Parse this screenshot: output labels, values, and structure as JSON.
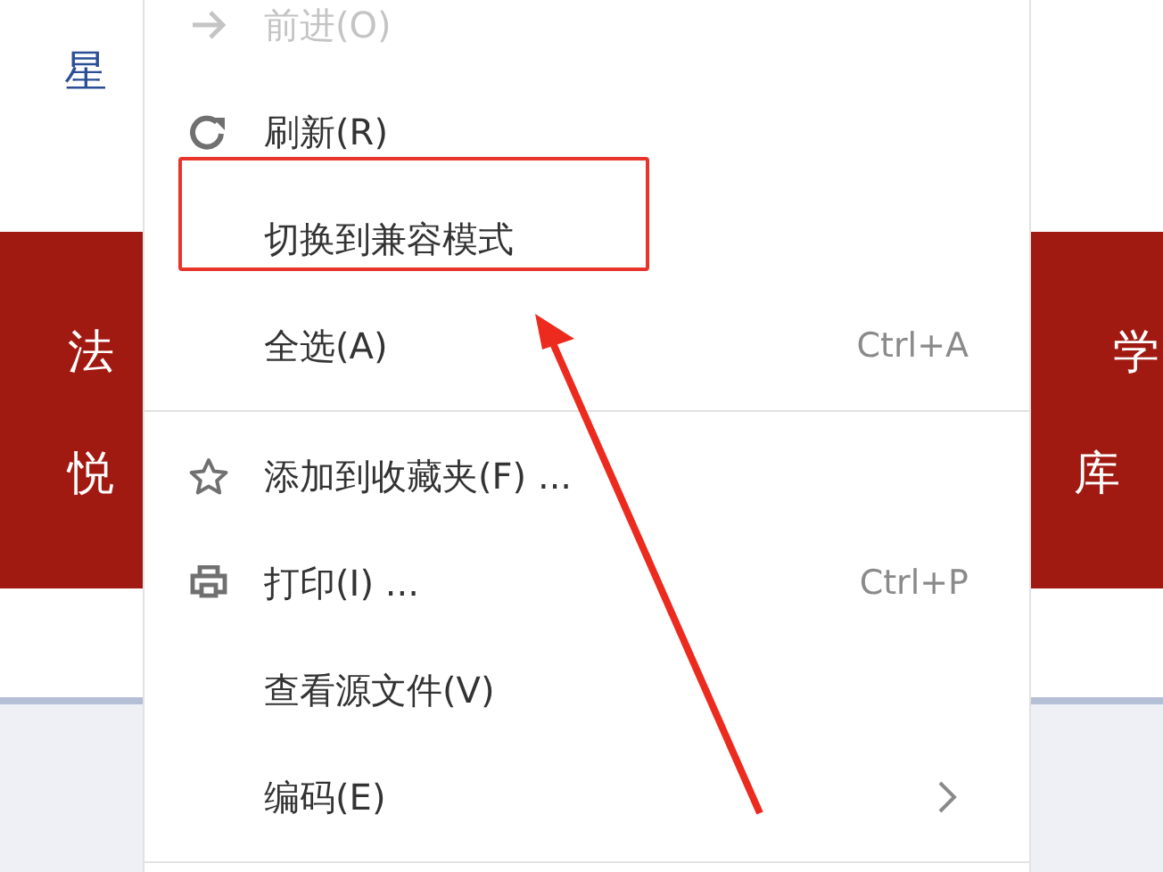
{
  "page_left": {
    "top_texts": [
      "星"
    ],
    "banner_texts": [
      "法",
      "悦"
    ]
  },
  "page_right": {
    "banner_texts": [
      "学",
      "库"
    ]
  },
  "context_menu": {
    "groups": [
      {
        "items": [
          {
            "label": "前进(O)",
            "kind": "forward",
            "disabled": true,
            "submenu": false
          },
          {
            "label": "刷新(R)",
            "kind": "refresh",
            "disabled": false,
            "submenu": false
          },
          {
            "label": "切换到兼容模式",
            "kind": "plain",
            "disabled": false,
            "submenu": false
          },
          {
            "label": "全选(A)",
            "kind": "plain",
            "disabled": false,
            "shortcut": "Ctrl+A",
            "submenu": false
          }
        ]
      },
      {
        "items": [
          {
            "label": "添加到收藏夹(F) ...",
            "kind": "favorite",
            "disabled": false,
            "submenu": false
          },
          {
            "label": "打印(I) ...",
            "kind": "print",
            "disabled": false,
            "shortcut": "Ctrl+P",
            "submenu": false
          },
          {
            "label": "查看源文件(V)",
            "kind": "plain",
            "disabled": false,
            "submenu": false
          },
          {
            "label": "编码(E)",
            "kind": "plain",
            "disabled": false,
            "submenu": true
          }
        ]
      }
    ]
  }
}
